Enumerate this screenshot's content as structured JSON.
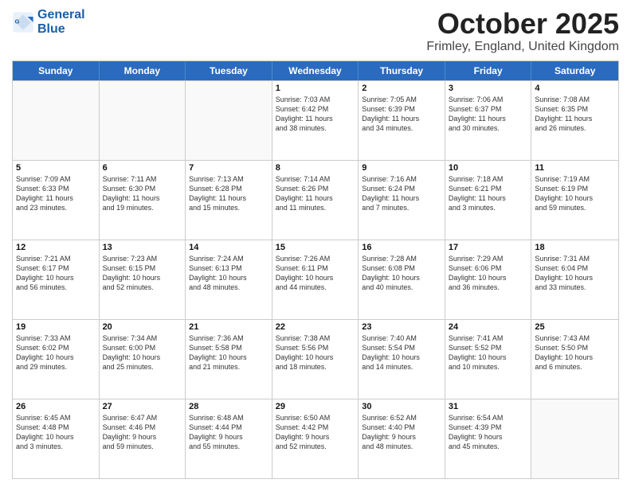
{
  "header": {
    "logo_general": "General",
    "logo_blue": "Blue",
    "month_title": "October 2025",
    "location": "Frimley, England, United Kingdom"
  },
  "weekdays": [
    "Sunday",
    "Monday",
    "Tuesday",
    "Wednesday",
    "Thursday",
    "Friday",
    "Saturday"
  ],
  "rows": [
    [
      {
        "day": "",
        "text": ""
      },
      {
        "day": "",
        "text": ""
      },
      {
        "day": "",
        "text": ""
      },
      {
        "day": "1",
        "text": "Sunrise: 7:03 AM\nSunset: 6:42 PM\nDaylight: 11 hours\nand 38 minutes."
      },
      {
        "day": "2",
        "text": "Sunrise: 7:05 AM\nSunset: 6:39 PM\nDaylight: 11 hours\nand 34 minutes."
      },
      {
        "day": "3",
        "text": "Sunrise: 7:06 AM\nSunset: 6:37 PM\nDaylight: 11 hours\nand 30 minutes."
      },
      {
        "day": "4",
        "text": "Sunrise: 7:08 AM\nSunset: 6:35 PM\nDaylight: 11 hours\nand 26 minutes."
      }
    ],
    [
      {
        "day": "5",
        "text": "Sunrise: 7:09 AM\nSunset: 6:33 PM\nDaylight: 11 hours\nand 23 minutes."
      },
      {
        "day": "6",
        "text": "Sunrise: 7:11 AM\nSunset: 6:30 PM\nDaylight: 11 hours\nand 19 minutes."
      },
      {
        "day": "7",
        "text": "Sunrise: 7:13 AM\nSunset: 6:28 PM\nDaylight: 11 hours\nand 15 minutes."
      },
      {
        "day": "8",
        "text": "Sunrise: 7:14 AM\nSunset: 6:26 PM\nDaylight: 11 hours\nand 11 minutes."
      },
      {
        "day": "9",
        "text": "Sunrise: 7:16 AM\nSunset: 6:24 PM\nDaylight: 11 hours\nand 7 minutes."
      },
      {
        "day": "10",
        "text": "Sunrise: 7:18 AM\nSunset: 6:21 PM\nDaylight: 11 hours\nand 3 minutes."
      },
      {
        "day": "11",
        "text": "Sunrise: 7:19 AM\nSunset: 6:19 PM\nDaylight: 10 hours\nand 59 minutes."
      }
    ],
    [
      {
        "day": "12",
        "text": "Sunrise: 7:21 AM\nSunset: 6:17 PM\nDaylight: 10 hours\nand 56 minutes."
      },
      {
        "day": "13",
        "text": "Sunrise: 7:23 AM\nSunset: 6:15 PM\nDaylight: 10 hours\nand 52 minutes."
      },
      {
        "day": "14",
        "text": "Sunrise: 7:24 AM\nSunset: 6:13 PM\nDaylight: 10 hours\nand 48 minutes."
      },
      {
        "day": "15",
        "text": "Sunrise: 7:26 AM\nSunset: 6:11 PM\nDaylight: 10 hours\nand 44 minutes."
      },
      {
        "day": "16",
        "text": "Sunrise: 7:28 AM\nSunset: 6:08 PM\nDaylight: 10 hours\nand 40 minutes."
      },
      {
        "day": "17",
        "text": "Sunrise: 7:29 AM\nSunset: 6:06 PM\nDaylight: 10 hours\nand 36 minutes."
      },
      {
        "day": "18",
        "text": "Sunrise: 7:31 AM\nSunset: 6:04 PM\nDaylight: 10 hours\nand 33 minutes."
      }
    ],
    [
      {
        "day": "19",
        "text": "Sunrise: 7:33 AM\nSunset: 6:02 PM\nDaylight: 10 hours\nand 29 minutes."
      },
      {
        "day": "20",
        "text": "Sunrise: 7:34 AM\nSunset: 6:00 PM\nDaylight: 10 hours\nand 25 minutes."
      },
      {
        "day": "21",
        "text": "Sunrise: 7:36 AM\nSunset: 5:58 PM\nDaylight: 10 hours\nand 21 minutes."
      },
      {
        "day": "22",
        "text": "Sunrise: 7:38 AM\nSunset: 5:56 PM\nDaylight: 10 hours\nand 18 minutes."
      },
      {
        "day": "23",
        "text": "Sunrise: 7:40 AM\nSunset: 5:54 PM\nDaylight: 10 hours\nand 14 minutes."
      },
      {
        "day": "24",
        "text": "Sunrise: 7:41 AM\nSunset: 5:52 PM\nDaylight: 10 hours\nand 10 minutes."
      },
      {
        "day": "25",
        "text": "Sunrise: 7:43 AM\nSunset: 5:50 PM\nDaylight: 10 hours\nand 6 minutes."
      }
    ],
    [
      {
        "day": "26",
        "text": "Sunrise: 6:45 AM\nSunset: 4:48 PM\nDaylight: 10 hours\nand 3 minutes."
      },
      {
        "day": "27",
        "text": "Sunrise: 6:47 AM\nSunset: 4:46 PM\nDaylight: 9 hours\nand 59 minutes."
      },
      {
        "day": "28",
        "text": "Sunrise: 6:48 AM\nSunset: 4:44 PM\nDaylight: 9 hours\nand 55 minutes."
      },
      {
        "day": "29",
        "text": "Sunrise: 6:50 AM\nSunset: 4:42 PM\nDaylight: 9 hours\nand 52 minutes."
      },
      {
        "day": "30",
        "text": "Sunrise: 6:52 AM\nSunset: 4:40 PM\nDaylight: 9 hours\nand 48 minutes."
      },
      {
        "day": "31",
        "text": "Sunrise: 6:54 AM\nSunset: 4:39 PM\nDaylight: 9 hours\nand 45 minutes."
      },
      {
        "day": "",
        "text": ""
      }
    ]
  ]
}
